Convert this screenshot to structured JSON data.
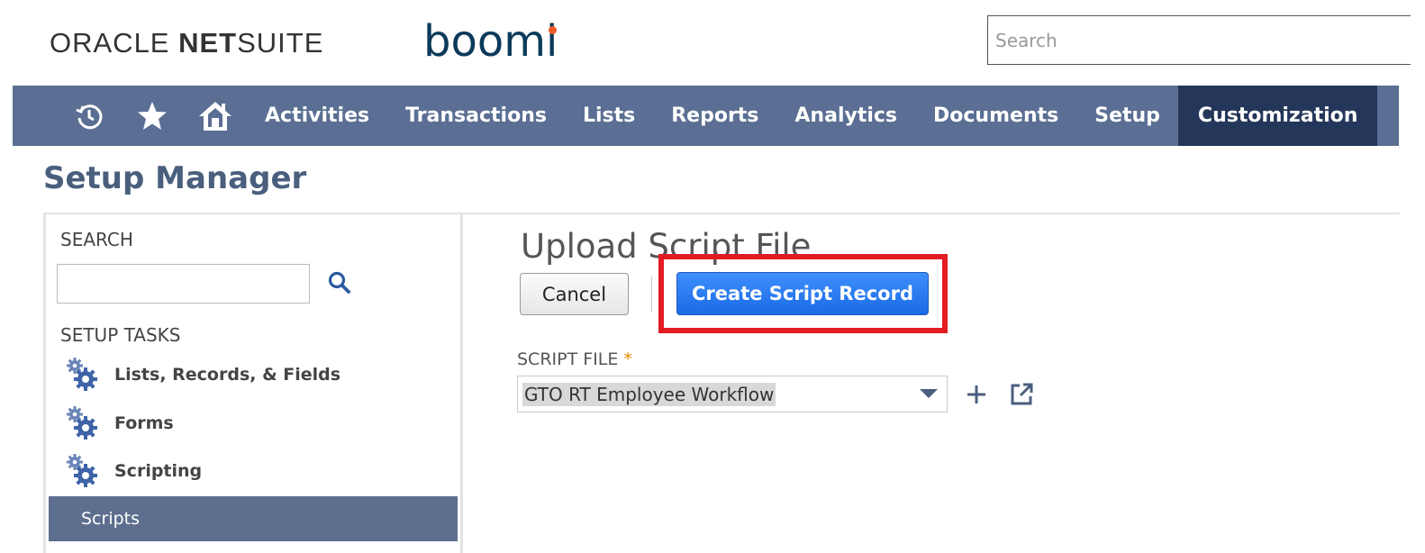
{
  "header": {
    "brand_oracle_light": "ORACLE ",
    "brand_oracle_bold": "NET",
    "brand_oracle_suffix": "SUITE",
    "brand_boomi_pre": "boom",
    "brand_boomi_i": "i",
    "search_placeholder": "Search"
  },
  "navbar": {
    "icons": [
      "recent-history-icon",
      "star-icon",
      "home-icon"
    ],
    "items": [
      {
        "label": "Activities"
      },
      {
        "label": "Transactions"
      },
      {
        "label": "Lists"
      },
      {
        "label": "Reports"
      },
      {
        "label": "Analytics"
      },
      {
        "label": "Documents"
      },
      {
        "label": "Setup"
      },
      {
        "label": "Customization"
      }
    ],
    "active_item": "Customization"
  },
  "page": {
    "title": "Setup Manager"
  },
  "sidebar": {
    "search_label": "SEARCH",
    "search_value": "",
    "tasks_label": "SETUP TASKS",
    "tasks": [
      {
        "label": "Lists, Records, & Fields",
        "icon": "gears-icon"
      },
      {
        "label": "Forms",
        "icon": "gears-icon"
      },
      {
        "label": "Scripting",
        "icon": "gears-icon"
      }
    ],
    "selected_item": "Scripts"
  },
  "form": {
    "title": "Upload Script File",
    "cancel_label": "Cancel",
    "create_label": "Create Script Record",
    "script_file_label": "SCRIPT FILE",
    "required_marker": "*",
    "script_file_value": "GTO RT Employee Workflow"
  },
  "colors": {
    "nav_bg": "#5a6f93",
    "nav_active_bg": "#24365a",
    "primary_button": "#1a6ae6",
    "highlight": "#e31b23",
    "boomi_blue": "#0b3a5a",
    "boomi_orange": "#f05a28"
  }
}
